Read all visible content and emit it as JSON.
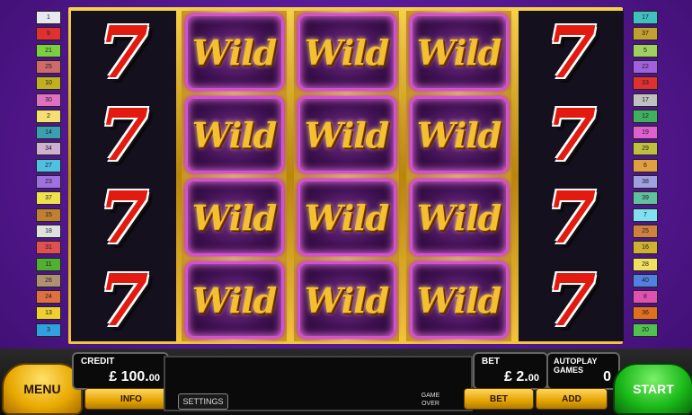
{
  "reels": [
    {
      "kind": "seven",
      "symbols": [
        "7",
        "7",
        "7",
        "7"
      ]
    },
    {
      "kind": "wild",
      "symbols": [
        "Wild",
        "Wild",
        "Wild",
        "Wild"
      ]
    },
    {
      "kind": "wild",
      "symbols": [
        "Wild",
        "Wild",
        "Wild",
        "Wild"
      ]
    },
    {
      "kind": "wild",
      "symbols": [
        "Wild",
        "Wild",
        "Wild",
        "Wild"
      ]
    },
    {
      "kind": "seven",
      "symbols": [
        "7",
        "7",
        "7",
        "7"
      ]
    }
  ],
  "paylines_left": [
    {
      "n": "1",
      "color": "#e8e8f0"
    },
    {
      "n": "9",
      "color": "#e03030"
    },
    {
      "n": "21",
      "color": "#7ad040"
    },
    {
      "n": "25",
      "color": "#d06a6a"
    },
    {
      "n": "10",
      "color": "#c0b020"
    },
    {
      "n": "30",
      "color": "#e070c0"
    },
    {
      "n": "2",
      "color": "#f4e070"
    },
    {
      "n": "14",
      "color": "#3aa0b0"
    },
    {
      "n": "34",
      "color": "#d0b0d0"
    },
    {
      "n": "27",
      "color": "#50c0e0"
    },
    {
      "n": "23",
      "color": "#a070e0"
    },
    {
      "n": "37",
      "color": "#f0e050"
    },
    {
      "n": "15",
      "color": "#c08030"
    },
    {
      "n": "18",
      "color": "#e0e0e0"
    },
    {
      "n": "31",
      "color": "#e05050"
    },
    {
      "n": "11",
      "color": "#50b030"
    },
    {
      "n": "26",
      "color": "#b09070"
    },
    {
      "n": "24",
      "color": "#e07040"
    },
    {
      "n": "13",
      "color": "#f0d030"
    },
    {
      "n": "3",
      "color": "#30a0e0"
    }
  ],
  "paylines_right": [
    {
      "n": "17",
      "color": "#40c0c0"
    },
    {
      "n": "37",
      "color": "#c0a030"
    },
    {
      "n": "5",
      "color": "#a0d060"
    },
    {
      "n": "22",
      "color": "#a060e0"
    },
    {
      "n": "33",
      "color": "#e03030"
    },
    {
      "n": "17",
      "color": "#c0c0c0"
    },
    {
      "n": "12",
      "color": "#40b060"
    },
    {
      "n": "19",
      "color": "#e060d0"
    },
    {
      "n": "29",
      "color": "#c0c040"
    },
    {
      "n": "6",
      "color": "#e0a040"
    },
    {
      "n": "38",
      "color": "#a0a0e0"
    },
    {
      "n": "39",
      "color": "#60c0a0"
    },
    {
      "n": "7",
      "color": "#80e0f0"
    },
    {
      "n": "25",
      "color": "#d08040"
    },
    {
      "n": "16",
      "color": "#d0b030"
    },
    {
      "n": "28",
      "color": "#f0e060"
    },
    {
      "n": "40",
      "color": "#5080e0"
    },
    {
      "n": "8",
      "color": "#e050b0"
    },
    {
      "n": "36",
      "color": "#e07020"
    },
    {
      "n": "20",
      "color": "#50c050"
    }
  ],
  "controls": {
    "menu_label": "MENU",
    "credit_label": "CREDIT",
    "credit_currency": "£",
    "credit_main": "100.",
    "credit_cents": "00",
    "info_label": "INFO",
    "settings_label": "SETTINGS",
    "game_over_line1": "GAME",
    "game_over_line2": "OVER",
    "bet_label": "BET",
    "bet_currency": "£",
    "bet_main": "2.",
    "bet_cents": "00",
    "bet_button_label": "BET",
    "autoplay_label": "AUTOPLAY GAMES",
    "autoplay_value": "0",
    "add_label": "ADD",
    "start_label": "START"
  }
}
